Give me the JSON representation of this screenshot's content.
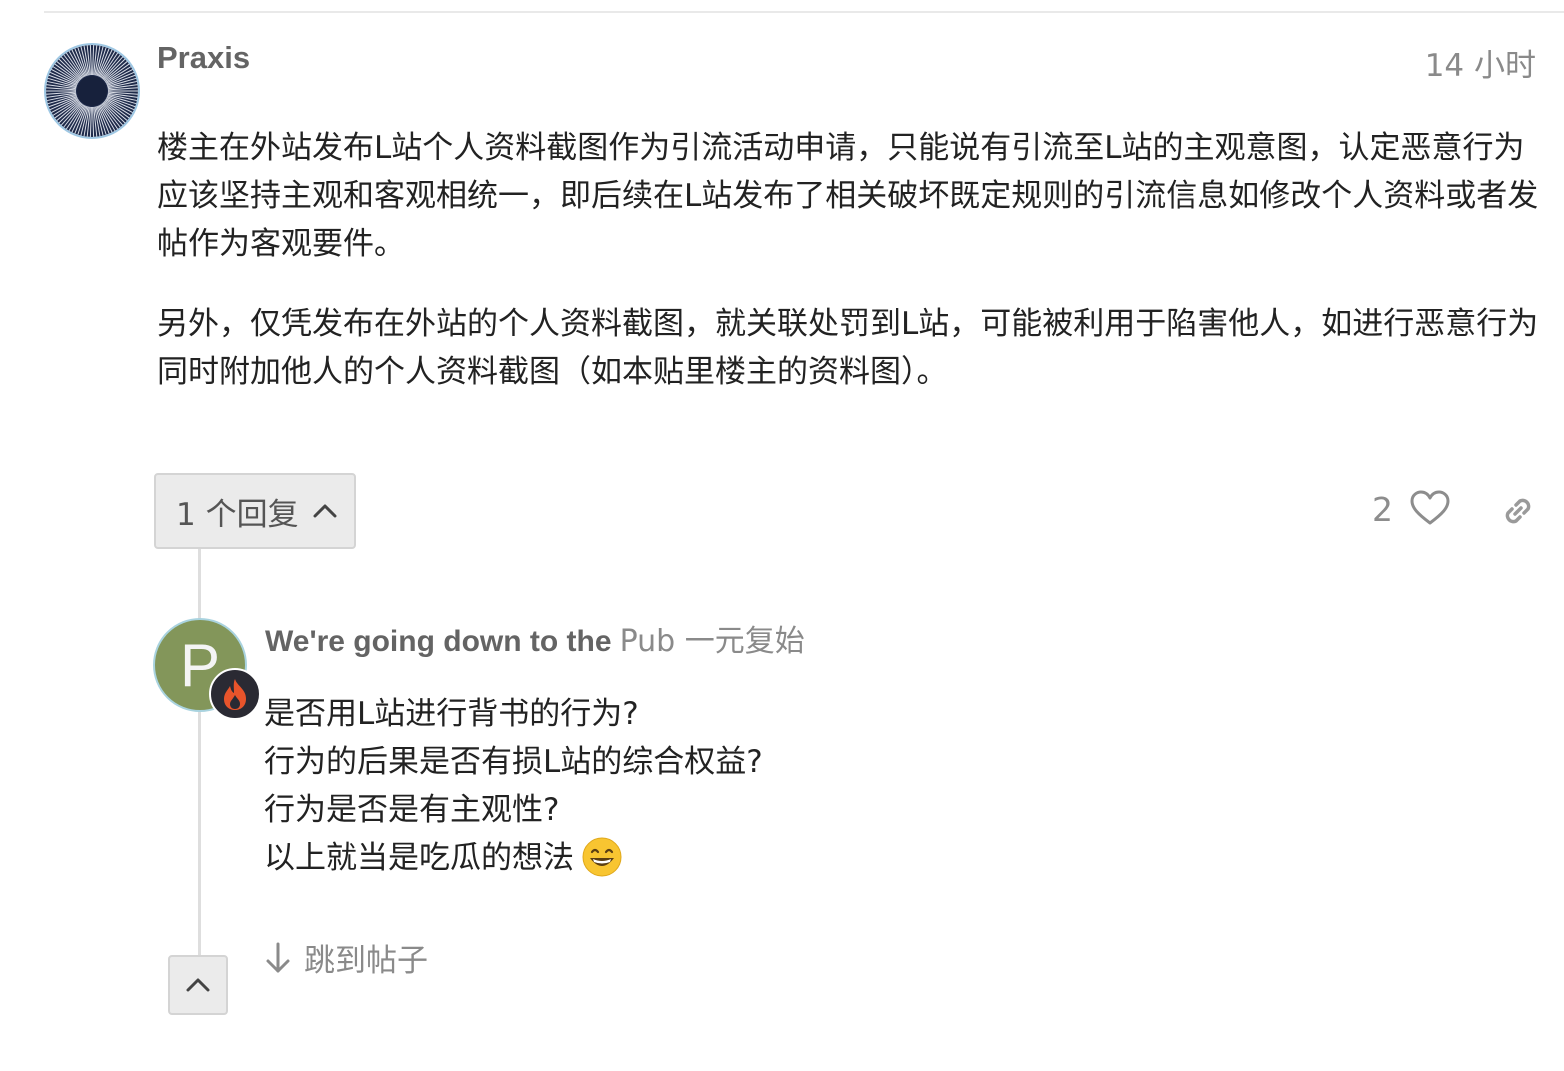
{
  "post": {
    "username": "Praxis",
    "time": "14 小时",
    "paragraphs": [
      "楼主在外站发布L站个人资料截图作为引流活动申请，只能说有引流至L站的主观意图，认定恶意行为应该坚持主观和客观相统一，即后续在L站发布了相关破坏既定规则的引流信息如修改个人资料或者发帖作为客观要件。",
      "另外，仅凭发布在外站的个人资料截图，就关联处罚到L站，可能被利用于陷害他人，如进行恶意行为同时附加他人的个人资料截图（如本贴里楼主的资料图）。"
    ],
    "replies_label": "1 个回复",
    "like_count": "2"
  },
  "reply": {
    "avatar_letter": "P",
    "name": "We're going down to the",
    "user": "Pub 一元复始",
    "lines": [
      "是否用L站进行背书的行为?",
      "行为的后果是否有损L站的综合权益?",
      "行为是否是有主观性?",
      "以上就当是吃瓜的想法"
    ],
    "emoji": "grinning-face-emoji"
  },
  "jump_label": "跳到帖子",
  "icons": {
    "like": "heart-icon",
    "link": "link-icon",
    "replies": "chevron-up-icon",
    "flair": "flame-icon",
    "jump": "arrow-down-icon",
    "collapse": "chevron-up-icon"
  },
  "colors": {
    "avatar_reply": "#83965a",
    "avatar_border": "#9fc8e4",
    "flair_bg": "#2a2a33",
    "flame": "#e8542b",
    "muted_text": "#8a8a8a"
  }
}
